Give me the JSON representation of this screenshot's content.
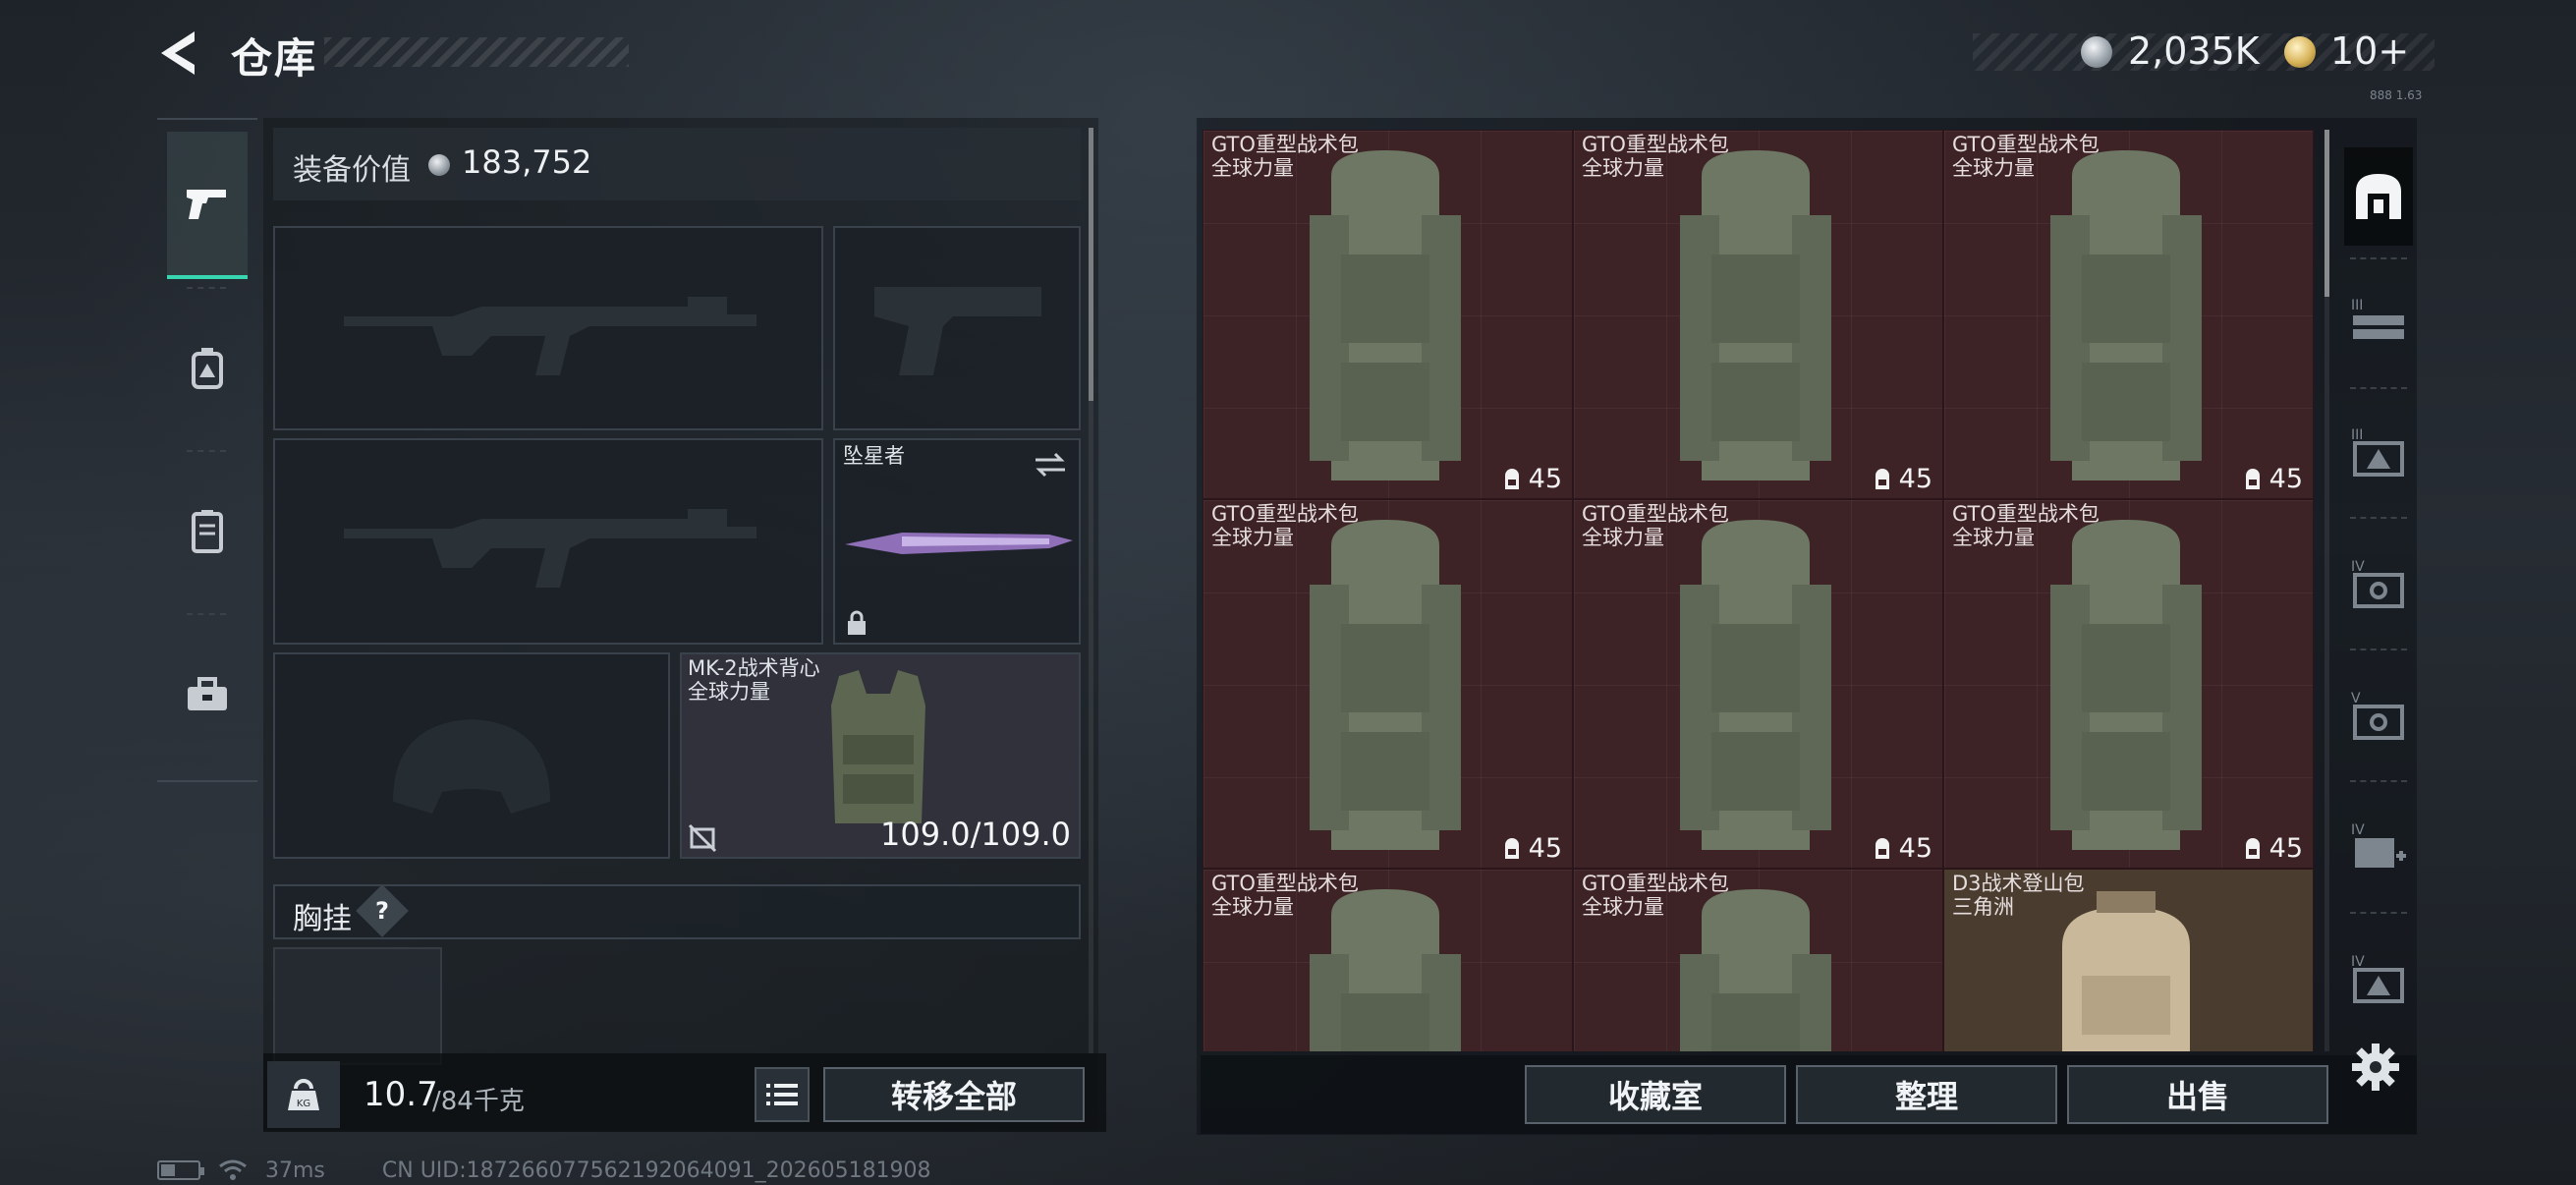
{
  "header": {
    "title": "仓库",
    "currency_silver": "2,035K",
    "currency_gold": "10+",
    "tiny_label": "888 1.63"
  },
  "category_tabs": [
    {
      "name": "weapons",
      "icon": "pistol-icon",
      "active": true
    },
    {
      "name": "gear",
      "icon": "backpack-armor-icon",
      "active": false
    },
    {
      "name": "storage",
      "icon": "locker-icon",
      "active": false
    },
    {
      "name": "supplies",
      "icon": "toolbox-icon",
      "active": false
    }
  ],
  "equipment": {
    "value_label": "装备价值",
    "value_number": "183,752",
    "melee_slot_name": "坠星者",
    "armor_slot_name": "MK-2战术背心",
    "armor_slot_sub": "全球力量",
    "armor_durability": "109.0/109.0",
    "chest_rig_label": "胸挂",
    "chest_rig_help": "?"
  },
  "carry": {
    "weight_now": "10.7",
    "weight_max": "/84千克",
    "transfer_all": "转移全部"
  },
  "storage_items": [
    {
      "name": "GTO重型战术包",
      "sub": "全球力量",
      "capacity": "45",
      "color": "red"
    },
    {
      "name": "GTO重型战术包",
      "sub": "全球力量",
      "capacity": "45",
      "color": "red"
    },
    {
      "name": "GTO重型战术包",
      "sub": "全球力量",
      "capacity": "45",
      "color": "red"
    },
    {
      "name": "GTO重型战术包",
      "sub": "全球力量",
      "capacity": "45",
      "color": "red"
    },
    {
      "name": "GTO重型战术包",
      "sub": "全球力量",
      "capacity": "45",
      "color": "red"
    },
    {
      "name": "GTO重型战术包",
      "sub": "全球力量",
      "capacity": "45",
      "color": "red"
    },
    {
      "name": "GTO重型战术包",
      "sub": "全球力量",
      "capacity": "",
      "color": "red"
    },
    {
      "name": "GTO重型战术包",
      "sub": "全球力量",
      "capacity": "",
      "color": "red"
    },
    {
      "name": "D3战术登山包",
      "sub": "三角洲",
      "capacity": "",
      "color": "tan"
    }
  ],
  "storage_actions": {
    "vault": "收藏室",
    "sort": "整理",
    "sell": "出售"
  },
  "side_tabs": [
    {
      "icon": "vault-arch-icon",
      "tier": ""
    },
    {
      "icon": "rifle-rack-icon",
      "tier": "III"
    },
    {
      "icon": "armor-crate-icon",
      "tier": "III"
    },
    {
      "icon": "tools-crate-icon",
      "tier": "IV"
    },
    {
      "icon": "tools-crate-icon",
      "tier": "V"
    },
    {
      "icon": "medkit-crate-icon",
      "tier": "IV"
    },
    {
      "icon": "armor-crate-icon",
      "tier": "IV"
    }
  ],
  "status": {
    "ping": "37ms",
    "uid": "CN UID:1872660775621920640​91_202605181908"
  },
  "colors": {
    "accent_teal": "#38d6b0",
    "cell_red": "#3d2226",
    "cell_tan": "#4a3d30"
  }
}
